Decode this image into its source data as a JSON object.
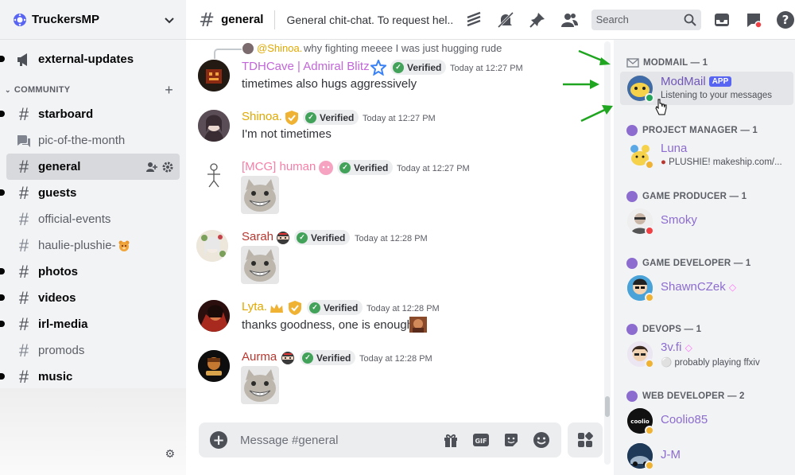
{
  "server": {
    "name": "TruckersMP"
  },
  "sidebar": {
    "top_channel": {
      "label": "external-updates"
    },
    "category": {
      "label": "COMMUNITY"
    },
    "channels": [
      {
        "label": "starboard"
      },
      {
        "label": "pic-of-the-month"
      },
      {
        "label": "general"
      },
      {
        "label": "guests"
      },
      {
        "label": "official-events"
      },
      {
        "label": "haulie-plushie-"
      },
      {
        "label": "photos"
      },
      {
        "label": "videos"
      },
      {
        "label": "irl-media"
      },
      {
        "label": "promods"
      },
      {
        "label": "music"
      }
    ]
  },
  "topbar": {
    "channel_name": "general",
    "topic": "General chit-chat. To request hel...",
    "search_placeholder": "Search"
  },
  "messages": [
    {
      "reply_to": "@Shinoa.",
      "reply_text": "why fighting meeee I was just hugging rude",
      "author": "TDHCave | Admiral Blitz",
      "author_color": "#c266d9",
      "verified": "Verified",
      "time": "Today at 12:27 PM",
      "text": "timetimes also hugs aggressively"
    },
    {
      "author": "Shinoa.",
      "author_color": "#e0a800",
      "verified": "Verified",
      "time": "Today at 12:27 PM",
      "text": "I'm not timetimes"
    },
    {
      "author": "[MCG] human",
      "author_color": "#f47fa8",
      "verified": "Verified",
      "time": "Today at 12:27 PM",
      "text": ""
    },
    {
      "author": "Sarah",
      "author_color": "#b8372f",
      "verified": "Verified",
      "time": "Today at 12:28 PM",
      "text": ""
    },
    {
      "author": "Lyta.",
      "author_color": "#e0a800",
      "verified": "Verified",
      "time": "Today at 12:28 PM",
      "text": "thanks goodness, one is enough"
    },
    {
      "author": "Aurma",
      "author_color": "#b8372f",
      "verified": "Verified",
      "time": "Today at 12:28 PM",
      "text": ""
    }
  ],
  "composer": {
    "placeholder": "Message #general"
  },
  "members": {
    "groups": [
      {
        "title": "MODMAIL — 1"
      },
      {
        "title": "PROJECT MANAGER — 1"
      },
      {
        "title": "GAME PRODUCER — 1"
      },
      {
        "title": "GAME DEVELOPER — 1"
      },
      {
        "title": "DEVOPS — 1"
      },
      {
        "title": "WEB DEVELOPER — 2"
      }
    ],
    "list": [
      {
        "name": "ModMail",
        "tag": "APP",
        "sub": "Listening to your messages"
      },
      {
        "name": "Luna",
        "sub": "PLUSHIE! makeship.com/..."
      },
      {
        "name": "Smoky",
        "sub": ""
      },
      {
        "name": "ShawnCZek",
        "sub": ""
      },
      {
        "name": "3v.fi",
        "sub": "probably playing ffxiv"
      },
      {
        "name": "Coolio85",
        "sub": ""
      },
      {
        "name": "J-M",
        "sub": ""
      }
    ]
  },
  "colors": {
    "accent": "#5865f2",
    "verified_green": "#43a25a",
    "role_purple": "#8c6ccf",
    "annotation_arrow": "#1fa51f"
  }
}
